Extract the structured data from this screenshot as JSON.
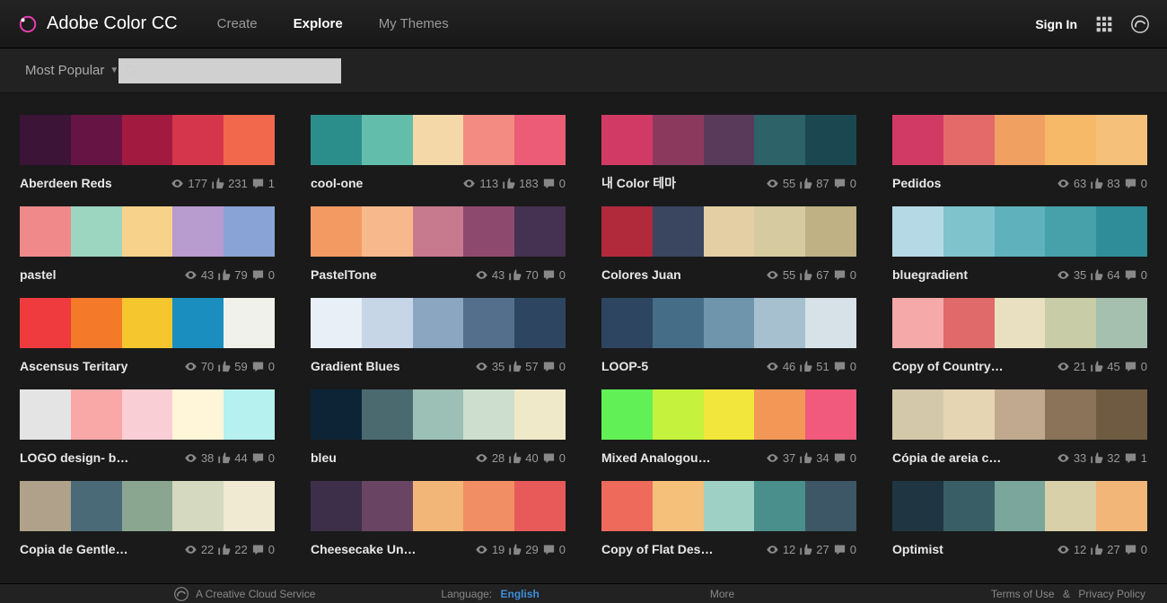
{
  "header": {
    "app_name": "Adobe Color CC",
    "nav": {
      "create": "Create",
      "explore": "Explore",
      "my_themes": "My Themes"
    },
    "sign_in": "Sign In"
  },
  "subheader": {
    "filter_label": "Most Popular",
    "search_placeholder": ""
  },
  "footer": {
    "ccs": "A Creative Cloud Service",
    "lang_label": "Language:",
    "lang_value": "English",
    "more": "More",
    "terms": "Terms of Use",
    "and": "&",
    "privacy": "Privacy Policy"
  },
  "themes": [
    {
      "title": "Aberdeen Reds",
      "views": 177,
      "likes": 231,
      "comments": 1,
      "colors": [
        "#3b1438",
        "#661444",
        "#a21a3f",
        "#d6364c",
        "#f1684c"
      ]
    },
    {
      "title": "cool-one",
      "views": 113,
      "likes": 183,
      "comments": 0,
      "colors": [
        "#2c8e8b",
        "#62bdaa",
        "#f4d8a8",
        "#f48b82",
        "#ec5c77"
      ]
    },
    {
      "title": "내 Color 테마",
      "views": 55,
      "likes": 87,
      "comments": 0,
      "colors": [
        "#d13a65",
        "#8b3a5e",
        "#5a3a5a",
        "#2d6268",
        "#1b4850"
      ]
    },
    {
      "title": "Pedidos",
      "views": 63,
      "likes": 83,
      "comments": 0,
      "colors": [
        "#d13a65",
        "#e46a6a",
        "#f0a060",
        "#f5b968",
        "#f5c07a"
      ]
    },
    {
      "title": "pastel",
      "views": 43,
      "likes": 79,
      "comments": 0,
      "colors": [
        "#f08a8a",
        "#9dd6c0",
        "#f7d28a",
        "#b89bcf",
        "#8aa3d6"
      ]
    },
    {
      "title": "PastelTone",
      "views": 43,
      "likes": 70,
      "comments": 0,
      "colors": [
        "#f39a63",
        "#f7b98c",
        "#c77a8e",
        "#8e4a6e",
        "#453151"
      ]
    },
    {
      "title": "Colores Juan",
      "views": 55,
      "likes": 67,
      "comments": 0,
      "colors": [
        "#b02a3c",
        "#3a4560",
        "#e3cfa3",
        "#d6cba0",
        "#bfb184"
      ]
    },
    {
      "title": "bluegradient",
      "views": 35,
      "likes": 64,
      "comments": 0,
      "colors": [
        "#b6d9e6",
        "#7fc3cd",
        "#5fb2bb",
        "#47a1ab",
        "#2f8d99"
      ]
    },
    {
      "title": "Ascensus Teritary",
      "views": 70,
      "likes": 59,
      "comments": 0,
      "colors": [
        "#ef3b3e",
        "#f47a2a",
        "#f6c62e",
        "#1a8fbf",
        "#f1f1eb"
      ]
    },
    {
      "title": "Gradient Blues",
      "views": 35,
      "likes": 57,
      "comments": 0,
      "colors": [
        "#e8eff7",
        "#c7d6e7",
        "#8aa6c1",
        "#536f8c",
        "#2d4560"
      ]
    },
    {
      "title": "LOOP-5",
      "views": 46,
      "likes": 51,
      "comments": 0,
      "colors": [
        "#2d4560",
        "#466d87",
        "#6f95ad",
        "#a7c0cf",
        "#d7e1e8"
      ]
    },
    {
      "title": "Copy of Country…",
      "views": 21,
      "likes": 45,
      "comments": 0,
      "colors": [
        "#f5a9a9",
        "#e06a6a",
        "#e8e0c0",
        "#c8cda8",
        "#a6c0af"
      ]
    },
    {
      "title": "LOGO design- b…",
      "views": 38,
      "likes": 44,
      "comments": 0,
      "colors": [
        "#e4e4e4",
        "#f9a7a7",
        "#f9cfd5",
        "#fff6d9",
        "#b6f0ef"
      ]
    },
    {
      "title": "bleu",
      "views": 28,
      "likes": 40,
      "comments": 0,
      "colors": [
        "#0d2436",
        "#4a6a6f",
        "#9cc0b5",
        "#cedece",
        "#f0e9c9"
      ]
    },
    {
      "title": "Mixed Analogou…",
      "views": 37,
      "likes": 34,
      "comments": 0,
      "colors": [
        "#61f055",
        "#c5f23c",
        "#f2e63c",
        "#f29756",
        "#f25a7d"
      ]
    },
    {
      "title": "Cópia de areia c…",
      "views": 33,
      "likes": 32,
      "comments": 1,
      "colors": [
        "#d4c8aa",
        "#e6d5b3",
        "#c0a98e",
        "#8a7358",
        "#6f5b42"
      ]
    },
    {
      "title": "Copia de Gentle…",
      "views": 22,
      "likes": 22,
      "comments": 0,
      "colors": [
        "#b0a28a",
        "#4a6a78",
        "#8aa690",
        "#d5d9bf",
        "#f0ead2"
      ]
    },
    {
      "title": "Cheesecake Un…",
      "views": 19,
      "likes": 29,
      "comments": 0,
      "colors": [
        "#3d2f4a",
        "#6a4563",
        "#f2b679",
        "#f28e63",
        "#e85a5a"
      ]
    },
    {
      "title": "Copy of Flat Des…",
      "views": 12,
      "likes": 27,
      "comments": 0,
      "colors": [
        "#ee6a5a",
        "#f4c07a",
        "#9ed0c3",
        "#4a8f8c",
        "#3d5766"
      ]
    },
    {
      "title": "Optimist",
      "views": 12,
      "likes": 27,
      "comments": 0,
      "colors": [
        "#1f3542",
        "#3a5e66",
        "#7aa69b",
        "#d8d0a8",
        "#f2b679"
      ]
    }
  ]
}
